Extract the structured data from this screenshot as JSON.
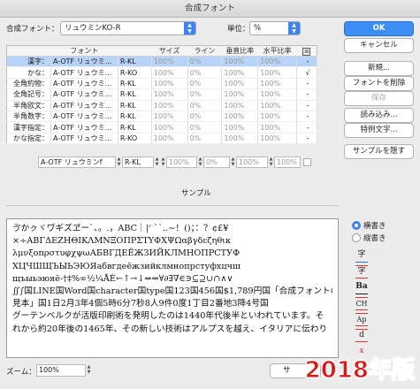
{
  "window": {
    "title": "合成フォント"
  },
  "top": {
    "font_label": "合成フォント：",
    "font_value": "リュウミンKO-R",
    "unit_label": "単位：",
    "unit_value": "%"
  },
  "grid": {
    "headers": [
      "",
      "フォント",
      "",
      "サイズ",
      "ライン",
      "垂直比率",
      "水平比率",
      ""
    ],
    "rows": [
      {
        "name": "漢字：",
        "font": "A-OTF リュウミ...",
        "style": "R-KL",
        "size": "100%",
        "line": "0%",
        "vert": "100%",
        "horiz": "100%",
        "mark": "-",
        "selected": true
      },
      {
        "name": "かな：",
        "font": "A-OTF リュウミ...",
        "style": "R-KO",
        "size": "100%",
        "line": "0%",
        "vert": "100%",
        "horiz": "100%",
        "mark": "√"
      },
      {
        "name": "全角約物：",
        "font": "A-OTF リュウミ...",
        "style": "R-KL",
        "size": "100%",
        "line": "0%",
        "vert": "100%",
        "horiz": "100%",
        "mark": "-"
      },
      {
        "name": "全角記号：",
        "font": "A-OTF リュウミ...",
        "style": "R-KL",
        "size": "100%",
        "line": "0%",
        "vert": "100%",
        "horiz": "100%",
        "mark": "-"
      },
      {
        "name": "半角欧文：",
        "font": "A-OTF リュウミ...",
        "style": "R-KL",
        "size": "100%",
        "line": "0%",
        "vert": "100%",
        "horiz": "100%",
        "mark": "-"
      },
      {
        "name": "半角数字：",
        "font": "A-OTF リュウミ...",
        "style": "R-KL",
        "size": "100%",
        "line": "0%",
        "vert": "100%",
        "horiz": "100%",
        "mark": "-"
      },
      {
        "name": "漢字指定：",
        "font": "A-OTF リュウミ...",
        "style": "R-KL",
        "size": "100%",
        "line": "0%",
        "vert": "100%",
        "horiz": "100%",
        "mark": "-"
      },
      {
        "name": "かな指定：",
        "font": "A-OTF リュウミ...",
        "style": "R-KO",
        "size": "100%",
        "line": "0%",
        "vert": "100%",
        "horiz": "100%",
        "mark": "-"
      }
    ]
  },
  "edit_row": {
    "font": "A-OTF リュウミンf",
    "style": "R-KL",
    "size": "100%",
    "line": "0%",
    "vert": "100%",
    "horiz": "100%"
  },
  "buttons": {
    "ok": "OK",
    "cancel": "キャンセル",
    "new": "新規...",
    "delete": "フォントを削除",
    "save": "保存",
    "load": "読み込み...",
    "special": "特例文字...",
    "hide_sample": "サンプルを隠す",
    "zoom_hidden_btn": "サ"
  },
  "sample": {
    "title": "サンプル",
    "lines": [
      "ゔかㇰヾヷギズヹー`、。.，ABC｜|‘ ``‥∼！()；：？¢£¥",
      "×÷ΑΒΓΔΕΖΗΘΙΚΛΜΝΞΟΠΡΣΤΥΦΧΨΩαβγδεζηθικ",
      "λμνξοπρστυφχψωАБВГДЕЁЖЗИЙКЛМНОПРСТУФ",
      "ХЦЧШЩЪЫЬЭЮЯабвгдеёжзийклмнопрстуфхцчш",
      "щъыьэюяё‐†‡%∞½¼ÅÉ←↑→↓⇒⇔∀∂∃∇∈∋⊆⊇∪∩∧∨",
      "∬∫国LINE国Word国character国type国123国456国$1,789円国「合成フォントの",
      "見本」国1日2月3年4個5時6分7秒8人9件0度1丁目2番地3降4号国",
      "グーテンベルクが活版印刷術を発明したのは1440年代後半といわれています。そ",
      "れから約20年後の1465年、その新しい技術はアルプスを越え、イタリアに伝わり"
    ]
  },
  "orientation": {
    "horizontal": "横書き",
    "vertical": "縦書き"
  },
  "zoom": {
    "label": "ズーム：",
    "value": "100%"
  },
  "badge": "2018年版"
}
